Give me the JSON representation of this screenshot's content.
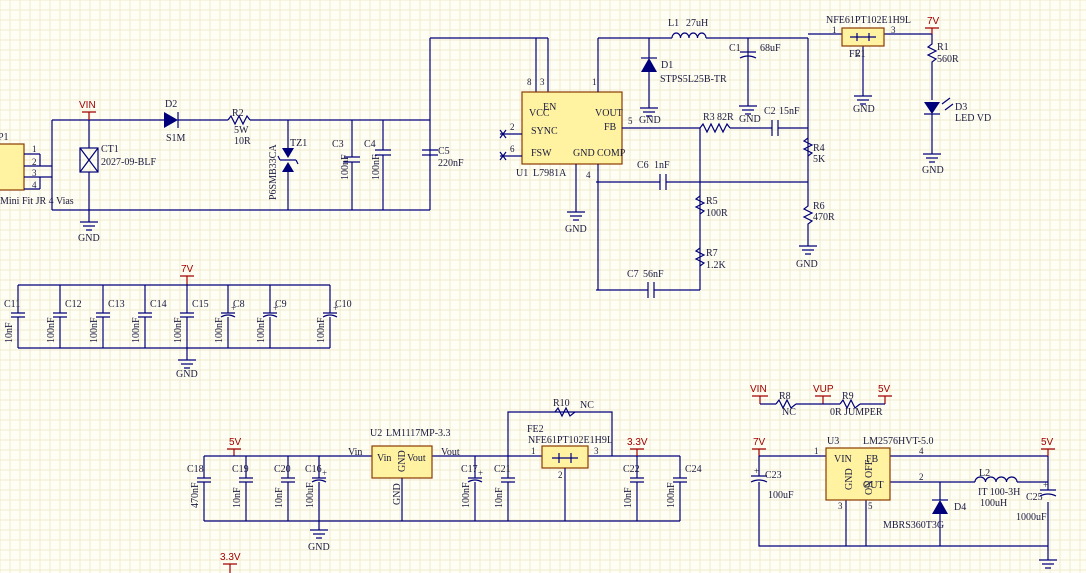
{
  "theme": {
    "background": "#fffef4",
    "wire": "#00007a",
    "power": "#a00000",
    "ic_fill": "#fff3a2",
    "ic_border": "#8a3a00",
    "text": "#1a1a40"
  },
  "connector": {
    "ref": "P1",
    "value": "Mini Fit JR 4 Vias",
    "pins": [
      "1",
      "2",
      "3",
      "4"
    ]
  },
  "power_ports": {
    "vin": "VIN",
    "v7": "7V",
    "v5": "5V",
    "v33": "3.3V",
    "vup": "VUP",
    "gnd": "GND"
  },
  "parts": {
    "ct1": {
      "ref": "CT1",
      "value": "2027-09-BLF"
    },
    "d2": {
      "ref": "D2",
      "value": "S1M"
    },
    "r2": {
      "ref": "R2",
      "value": "5W",
      "value2": "10R"
    },
    "tz1": {
      "ref": "TZ1",
      "value": "P6SMB33CA"
    },
    "c3": {
      "ref": "C3",
      "value": "100nF"
    },
    "c4": {
      "ref": "C4",
      "value": "100nF"
    },
    "c5": {
      "ref": "C5",
      "value": "220nF"
    },
    "u1": {
      "ref": "U1",
      "value": "L7981A",
      "pins": {
        "vcc": "VCC",
        "en": "EN",
        "sync": "SYNC",
        "fsw": "FSW",
        "gnd": "GND",
        "comp": "COMP",
        "vout": "VOUT",
        "fb": "FB",
        "n8": "8",
        "n3": "3",
        "n1": "1",
        "n2": "2",
        "n6": "6",
        "n5": "5",
        "n4": "4"
      }
    },
    "l1": {
      "ref": "L1",
      "value": "27uH"
    },
    "d1": {
      "ref": "D1",
      "value": "STPS5L25B-TR"
    },
    "c1": {
      "ref": "C1",
      "value": "68uF"
    },
    "fe1": {
      "ref": "FE1",
      "value": "NFE61PT102E1H9L",
      "pin1": "1",
      "pin2": "2",
      "pin3": "3"
    },
    "r1": {
      "ref": "R1",
      "value": "560R"
    },
    "d3": {
      "ref": "D3",
      "value": "LED VD"
    },
    "r3": {
      "ref": "R3",
      "value": "82R"
    },
    "c2": {
      "ref": "C2",
      "value": "15nF"
    },
    "r4": {
      "ref": "R4",
      "value": "5K"
    },
    "c6": {
      "ref": "C6",
      "value": "1nF"
    },
    "r5": {
      "ref": "R5",
      "value": "100R"
    },
    "r6": {
      "ref": "R6",
      "value": "470R"
    },
    "r7": {
      "ref": "R7",
      "value": "1.2K"
    },
    "c7": {
      "ref": "C7",
      "value": "56nF"
    },
    "bank": [
      {
        "ref": "C11",
        "value": "10nF"
      },
      {
        "ref": "C12",
        "value": "100nF"
      },
      {
        "ref": "C13",
        "value": "100nF"
      },
      {
        "ref": "C14",
        "value": "100nF"
      },
      {
        "ref": "C15",
        "value": "100nF"
      },
      {
        "ref": "C8",
        "value": "100nF"
      },
      {
        "ref": "C9",
        "value": "100nF"
      },
      {
        "ref": "C10",
        "value": "100nF"
      }
    ],
    "r8": {
      "ref": "R8",
      "value": "NC"
    },
    "r9": {
      "ref": "R9",
      "value": "0R JUMPER"
    },
    "r10": {
      "ref": "R10",
      "value": "NC"
    },
    "u2": {
      "ref": "U2",
      "value": "LM1117MP-3.3",
      "pins": {
        "vin": "Vin",
        "gnd": "GND",
        "vout": "Vout"
      },
      "net_in": "Vin",
      "net_out": "Vout",
      "gnd_label": "GND"
    },
    "fe2": {
      "ref": "FE2",
      "value": "NFE61PT102E1H9L",
      "pin1": "1",
      "pin2": "2",
      "pin3": "3"
    },
    "reg_caps": [
      {
        "ref": "C18",
        "value": "470nF"
      },
      {
        "ref": "C19",
        "value": "10nF"
      },
      {
        "ref": "C20",
        "value": "10nF"
      },
      {
        "ref": "C16",
        "value": "100uF"
      },
      {
        "ref": "C17",
        "value": "100nF"
      },
      {
        "ref": "C21",
        "value": "10nF"
      },
      {
        "ref": "C22",
        "value": "10nF"
      },
      {
        "ref": "C24",
        "value": "100nF"
      }
    ],
    "u3": {
      "ref": "U3",
      "value": "LM2576HVT-5.0",
      "pins": {
        "vin": "VIN",
        "fb": "FB",
        "out": "OUT",
        "gnd": "GND",
        "onoff": "ON OFF",
        "n1": "1",
        "n4": "4",
        "n2": "2",
        "n3": "3",
        "n5": "5"
      }
    },
    "c23": {
      "ref": "C23",
      "value": "100uF"
    },
    "l2": {
      "ref": "L2",
      "value": "IT 100-3H",
      "value2": "100uH"
    },
    "d4": {
      "ref": "D4",
      "value": "MBRS360T3G"
    },
    "c25": {
      "ref": "C25",
      "value": "1000uF"
    }
  }
}
